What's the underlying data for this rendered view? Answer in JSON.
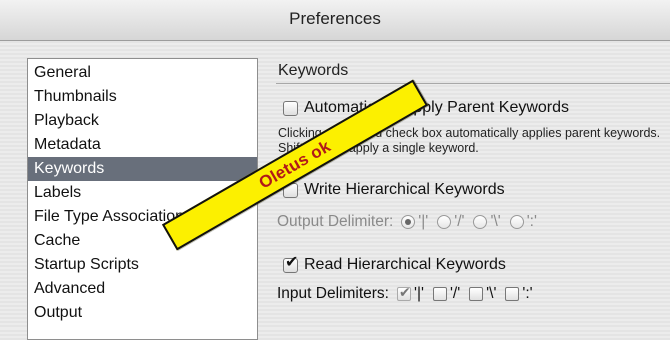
{
  "window": {
    "title": "Preferences"
  },
  "sidebar": {
    "items": [
      {
        "label": "General"
      },
      {
        "label": "Thumbnails"
      },
      {
        "label": "Playback"
      },
      {
        "label": "Metadata"
      },
      {
        "label": "Keywords",
        "selected": true
      },
      {
        "label": "Labels"
      },
      {
        "label": "File Type Associations"
      },
      {
        "label": "Cache"
      },
      {
        "label": "Startup Scripts"
      },
      {
        "label": "Advanced"
      },
      {
        "label": "Output"
      }
    ]
  },
  "main": {
    "section_title": "Keywords",
    "auto_apply": {
      "label": "Automatically Apply Parent Keywords",
      "checked": false,
      "description": "Clicking a keyword check box automatically applies parent keywords. Shift-click to apply a single keyword."
    },
    "write_hier": {
      "label": "Write Hierarchical Keywords",
      "checked": false,
      "delimiter_label": "Output Delimiter:",
      "options": [
        "'|'",
        "'/'",
        "'\\'",
        "':'"
      ],
      "selected": 0
    },
    "read_hier": {
      "label": "Read Hierarchical Keywords",
      "checked": true,
      "delimiter_label": "Input Delimiters:",
      "options": [
        "'|'",
        "'/'",
        "'\\'",
        "':'"
      ],
      "checked_options": [
        true,
        false,
        false,
        false
      ]
    }
  },
  "overlay": {
    "banner_text": "Oletus ok",
    "banner_color": "#fcf000",
    "text_color": "#b11919"
  },
  "icons": {
    "check": "check-icon",
    "radio": "radio-icon"
  }
}
